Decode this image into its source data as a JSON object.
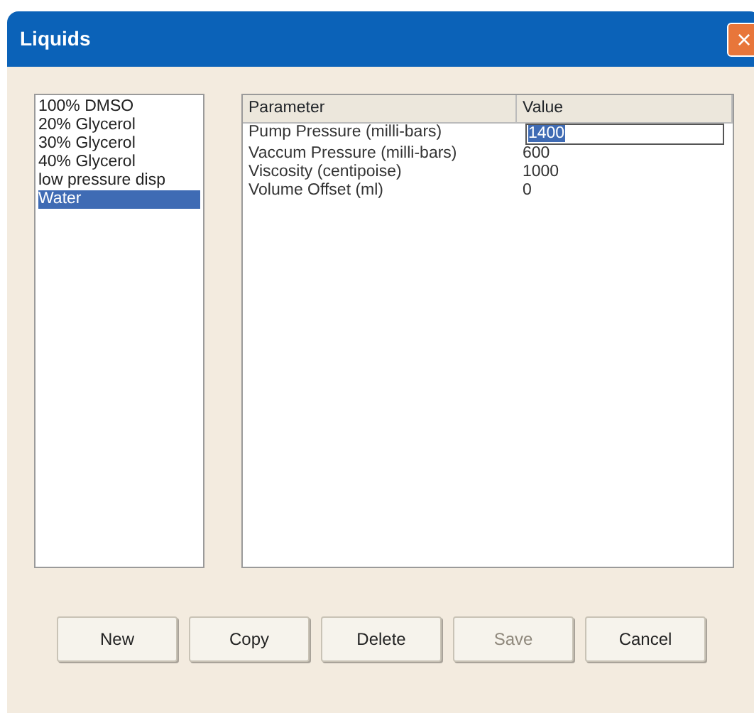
{
  "window": {
    "title": "Liquids",
    "close": "×"
  },
  "liquids": [
    {
      "name": "100% DMSO",
      "selected": false
    },
    {
      "name": "20% Glycerol",
      "selected": false
    },
    {
      "name": "30% Glycerol",
      "selected": false
    },
    {
      "name": "40% Glycerol",
      "selected": false
    },
    {
      "name": "low pressure disp",
      "selected": false
    },
    {
      "name": "Water",
      "selected": true
    }
  ],
  "table": {
    "columns": [
      "Parameter",
      "Value"
    ],
    "rows": [
      {
        "parameter": "Pump Pressure (milli-bars)",
        "value": "1400",
        "editing": true
      },
      {
        "parameter": "Vaccum Pressure (milli-bars)",
        "value": "600",
        "editing": false
      },
      {
        "parameter": "Viscosity (centipoise)",
        "value": "1000",
        "editing": false
      },
      {
        "parameter": "Volume Offset (ml)",
        "value": "0",
        "editing": false
      }
    ]
  },
  "buttons": [
    {
      "label": "New",
      "disabled": false
    },
    {
      "label": "Copy",
      "disabled": false
    },
    {
      "label": "Delete",
      "disabled": false
    },
    {
      "label": "Save",
      "disabled": true
    },
    {
      "label": "Cancel",
      "disabled": false
    }
  ]
}
